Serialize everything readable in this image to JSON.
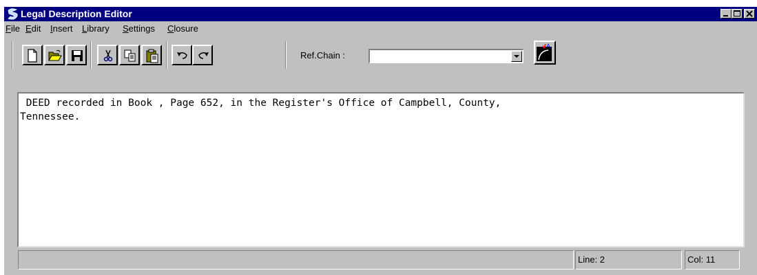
{
  "window": {
    "title": "Legal Description Editor",
    "title_bar_color": "#000080",
    "icons": [
      "app-logo-icon",
      "minimize-icon",
      "maximize-icon",
      "close-icon"
    ]
  },
  "menu": {
    "items": [
      {
        "label": "File",
        "accel": "F",
        "rest": "ile"
      },
      {
        "label": "Edit",
        "accel": "E",
        "rest": "dit"
      },
      {
        "label": "Insert",
        "accel": "I",
        "rest": "nsert"
      },
      {
        "label": "Library",
        "accel": "L",
        "rest": "ibrary"
      },
      {
        "label": "Settings",
        "accel": "S",
        "rest": "ettings"
      },
      {
        "label": "Closure",
        "accel": "C",
        "rest": "losure"
      }
    ]
  },
  "toolbar": {
    "buttons": [
      "new-document-icon",
      "open-folder-icon",
      "save-icon",
      "cut-icon",
      "copy-icon",
      "paste-icon",
      "undo-icon",
      "redo-icon"
    ],
    "refchain_label": "Ref.Chain :",
    "refchain_value": "",
    "chain_tool_icon": "chain-curve-icon"
  },
  "editor": {
    "lines": [
      " DEED recorded in Book , Page 652, in the Register's Office of Campbell, County,",
      "Tennessee."
    ]
  },
  "statusbar": {
    "message": "",
    "line": "Line: 2",
    "col": "Col: 11"
  }
}
